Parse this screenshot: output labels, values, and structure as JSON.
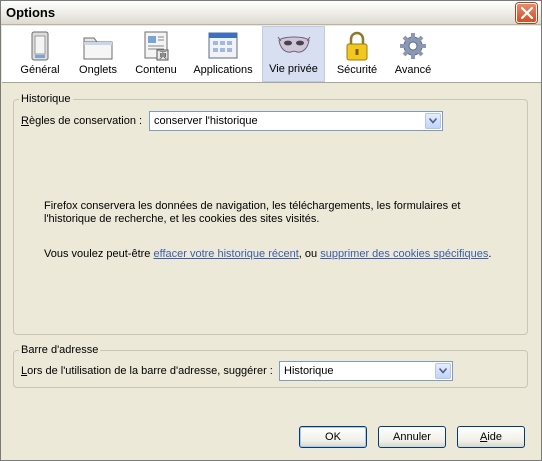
{
  "window": {
    "title": "Options"
  },
  "toolbar": {
    "items": [
      {
        "label": "Général",
        "icon": "general-icon"
      },
      {
        "label": "Onglets",
        "icon": "tabs-icon"
      },
      {
        "label": "Contenu",
        "icon": "content-icon"
      },
      {
        "label": "Applications",
        "icon": "applications-icon"
      },
      {
        "label": "Vie privée",
        "icon": "privacy-mask-icon",
        "selected": true
      },
      {
        "label": "Sécurité",
        "icon": "padlock-icon"
      },
      {
        "label": "Avancé",
        "icon": "gear-icon"
      }
    ]
  },
  "history": {
    "title": "Historique",
    "rules_label_first": "R",
    "rules_label_rest": "ègles de conservation :",
    "rules_value": "conserver l'historique",
    "description_line1": "Firefox conservera les données de navigation, les téléchargements, les formulaires et",
    "description_line2": "l'historique de recherche, et les cookies des sites visités.",
    "suggestion_prefix": "Vous voulez peut-être ",
    "link_clear": "effacer votre historique récent",
    "suggestion_middle": ", ou ",
    "link_cookies": "supprimer des cookies spécifiques",
    "suggestion_suffix": "."
  },
  "addressbar": {
    "title": "Barre d'adresse",
    "label_first": "L",
    "label_rest": "ors de l'utilisation de la barre d'adresse, suggérer :",
    "value": "Historique"
  },
  "buttons": {
    "ok": "OK",
    "cancel": "Annuler",
    "help_first": "A",
    "help_rest": "ide"
  },
  "colors": {
    "window_bg": "#ece9d8",
    "selected_tab_bg": "#d7dff0",
    "link": "#3b5dab",
    "close_button": "#d14e28"
  }
}
